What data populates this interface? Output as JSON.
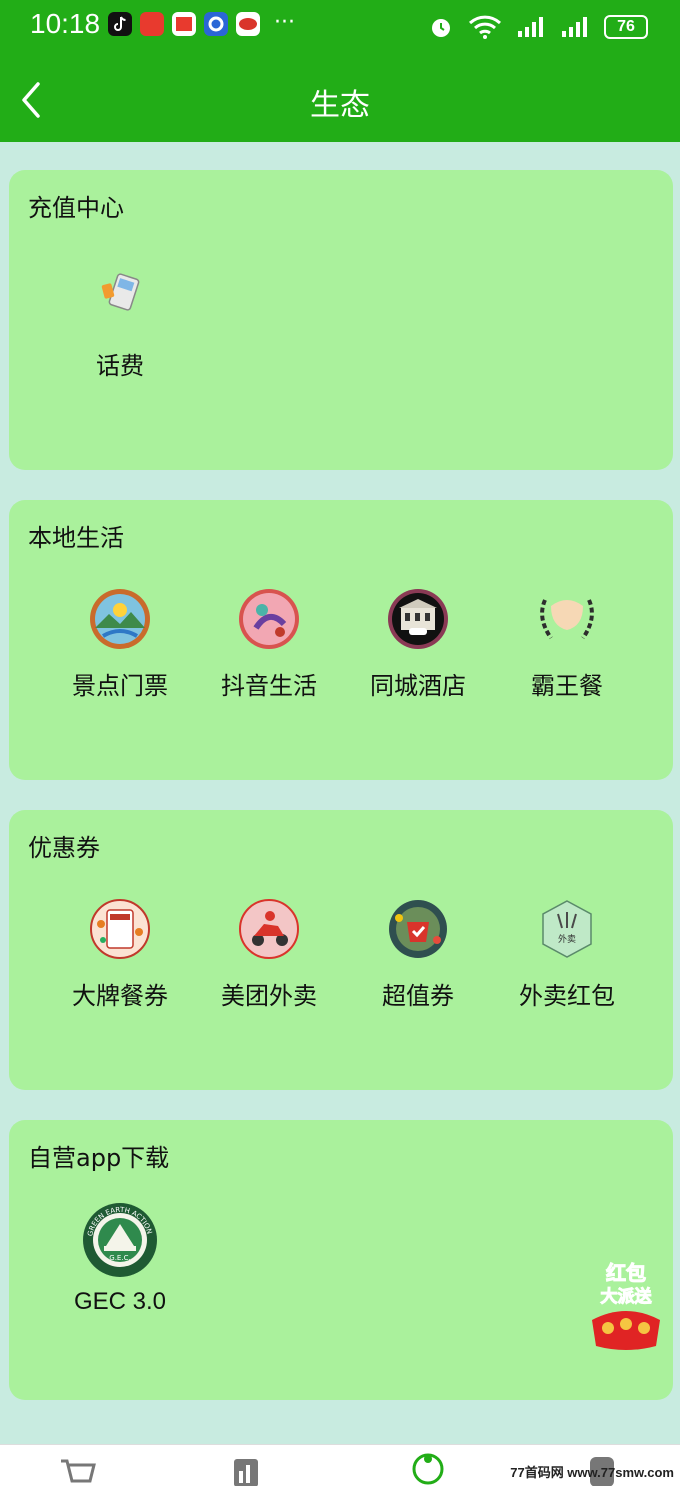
{
  "status_bar": {
    "time": "10:18",
    "battery": "76",
    "more": "···"
  },
  "header": {
    "title": "生态"
  },
  "sections": [
    {
      "title": "充值中心",
      "items": [
        {
          "label": "话费",
          "icon": "phone-recharge-icon"
        }
      ]
    },
    {
      "title": "本地生活",
      "items": [
        {
          "label": "景点门票",
          "icon": "scenic-ticket-icon"
        },
        {
          "label": "抖音生活",
          "icon": "douyin-life-icon"
        },
        {
          "label": "同城酒店",
          "icon": "hotel-icon"
        },
        {
          "label": "霸王餐",
          "icon": "free-meal-icon"
        }
      ]
    },
    {
      "title": "优惠券",
      "items": [
        {
          "label": "大牌餐券",
          "icon": "brand-meal-coupon-icon"
        },
        {
          "label": "美团外卖",
          "icon": "meituan-delivery-icon"
        },
        {
          "label": "超值券",
          "icon": "value-coupon-icon"
        },
        {
          "label": "外卖红包",
          "icon": "delivery-red-packet-icon"
        }
      ]
    },
    {
      "title": "自营app下载",
      "items": [
        {
          "label": "GEC 3.0",
          "icon": "gec-app-icon"
        }
      ]
    }
  ],
  "floating_badge": {
    "line1": "红包",
    "line2": "大派送"
  },
  "icon_texts": {
    "gec_ring": "GREEN EARTH ACTION",
    "gec_inner": "G.E.C.",
    "waimai": "外卖"
  },
  "watermark": "77首码网 www.77smw.com",
  "colors": {
    "header": "#22ad17",
    "page_bg": "#c8ebe0",
    "card_bg": "#aaf19c"
  }
}
